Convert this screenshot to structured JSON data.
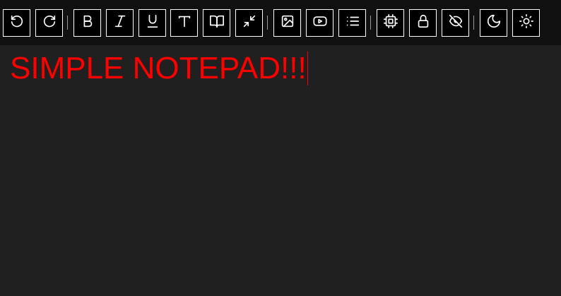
{
  "colors": {
    "toolbar_bg": "#111111",
    "editor_bg": "#202020",
    "button_border": "#ffffff",
    "text": "#ff0000"
  },
  "toolbar": {
    "buttons": [
      {
        "name": "undo-button",
        "icon": "undo-icon"
      },
      {
        "name": "redo-button",
        "icon": "redo-icon"
      },
      {
        "name": "bold-button",
        "icon": "bold-icon"
      },
      {
        "name": "italic-button",
        "icon": "italic-icon"
      },
      {
        "name": "underline-button",
        "icon": "underline-icon"
      },
      {
        "name": "text-style-button",
        "icon": "text-t-icon"
      },
      {
        "name": "reading-mode-button",
        "icon": "book-open-icon"
      },
      {
        "name": "minimize-button",
        "icon": "minimize-arrows-icon"
      },
      {
        "name": "insert-image-button",
        "icon": "image-icon"
      },
      {
        "name": "insert-video-button",
        "icon": "video-play-icon"
      },
      {
        "name": "list-button",
        "icon": "list-icon"
      },
      {
        "name": "cpu-button",
        "icon": "cpu-chip-icon"
      },
      {
        "name": "lock-button",
        "icon": "lock-icon"
      },
      {
        "name": "hide-button",
        "icon": "eye-off-icon"
      },
      {
        "name": "dark-mode-button",
        "icon": "moon-icon"
      },
      {
        "name": "light-mode-button",
        "icon": "sun-icon"
      }
    ]
  },
  "editor": {
    "content": "SIMPLE NOTEPAD!!!"
  }
}
